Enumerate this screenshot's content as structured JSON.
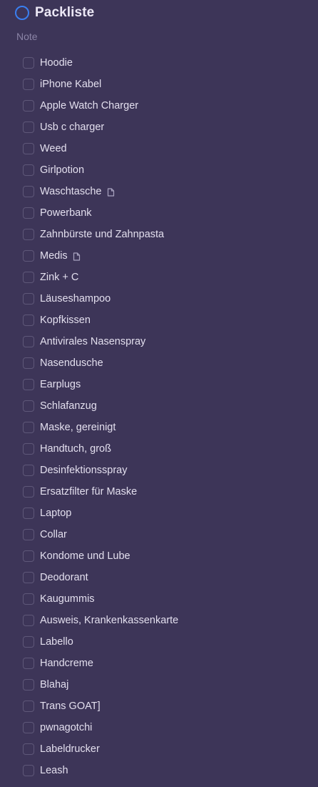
{
  "header": {
    "title": "Packliste",
    "note": "Note",
    "icon": "circle-project-icon",
    "accent_color": "#3a7ff0"
  },
  "items": [
    {
      "label": "Hoodie",
      "has_note": false
    },
    {
      "label": "iPhone Kabel",
      "has_note": false
    },
    {
      "label": "Apple Watch Charger",
      "has_note": false
    },
    {
      "label": "Usb c charger",
      "has_note": false
    },
    {
      "label": "Weed",
      "has_note": false
    },
    {
      "label": "Girlpotion",
      "has_note": false
    },
    {
      "label": "Waschtasche",
      "has_note": true
    },
    {
      "label": "Powerbank",
      "has_note": false
    },
    {
      "label": "Zahnbürste und Zahnpasta",
      "has_note": false
    },
    {
      "label": "Medis",
      "has_note": true
    },
    {
      "label": "Zink + C",
      "has_note": false
    },
    {
      "label": "Läuseshampoo",
      "has_note": false
    },
    {
      "label": "Kopfkissen",
      "has_note": false
    },
    {
      "label": "Antivirales Nasenspray",
      "has_note": false
    },
    {
      "label": "Nasendusche",
      "has_note": false
    },
    {
      "label": "Earplugs",
      "has_note": false
    },
    {
      "label": "Schlafanzug",
      "has_note": false
    },
    {
      "label": "Maske, gereinigt",
      "has_note": false
    },
    {
      "label": "Handtuch, groß",
      "has_note": false
    },
    {
      "label": "Desinfektionsspray",
      "has_note": false
    },
    {
      "label": "Ersatzfilter für Maske",
      "has_note": false
    },
    {
      "label": "Laptop",
      "has_note": false
    },
    {
      "label": "Collar",
      "has_note": false
    },
    {
      "label": "Kondome und Lube",
      "has_note": false
    },
    {
      "label": "Deodorant",
      "has_note": false
    },
    {
      "label": "Kaugummis",
      "has_note": false
    },
    {
      "label": "Ausweis, Krankenkassenkarte",
      "has_note": false
    },
    {
      "label": "Labello",
      "has_note": false
    },
    {
      "label": "Handcreme",
      "has_note": false
    },
    {
      "label": "Blahaj",
      "has_note": false
    },
    {
      "label": "Trans GOAT]",
      "has_note": false
    },
    {
      "label": "pwnagotchi",
      "has_note": false
    },
    {
      "label": "Labeldrucker",
      "has_note": false
    },
    {
      "label": "Leash",
      "has_note": false
    }
  ]
}
